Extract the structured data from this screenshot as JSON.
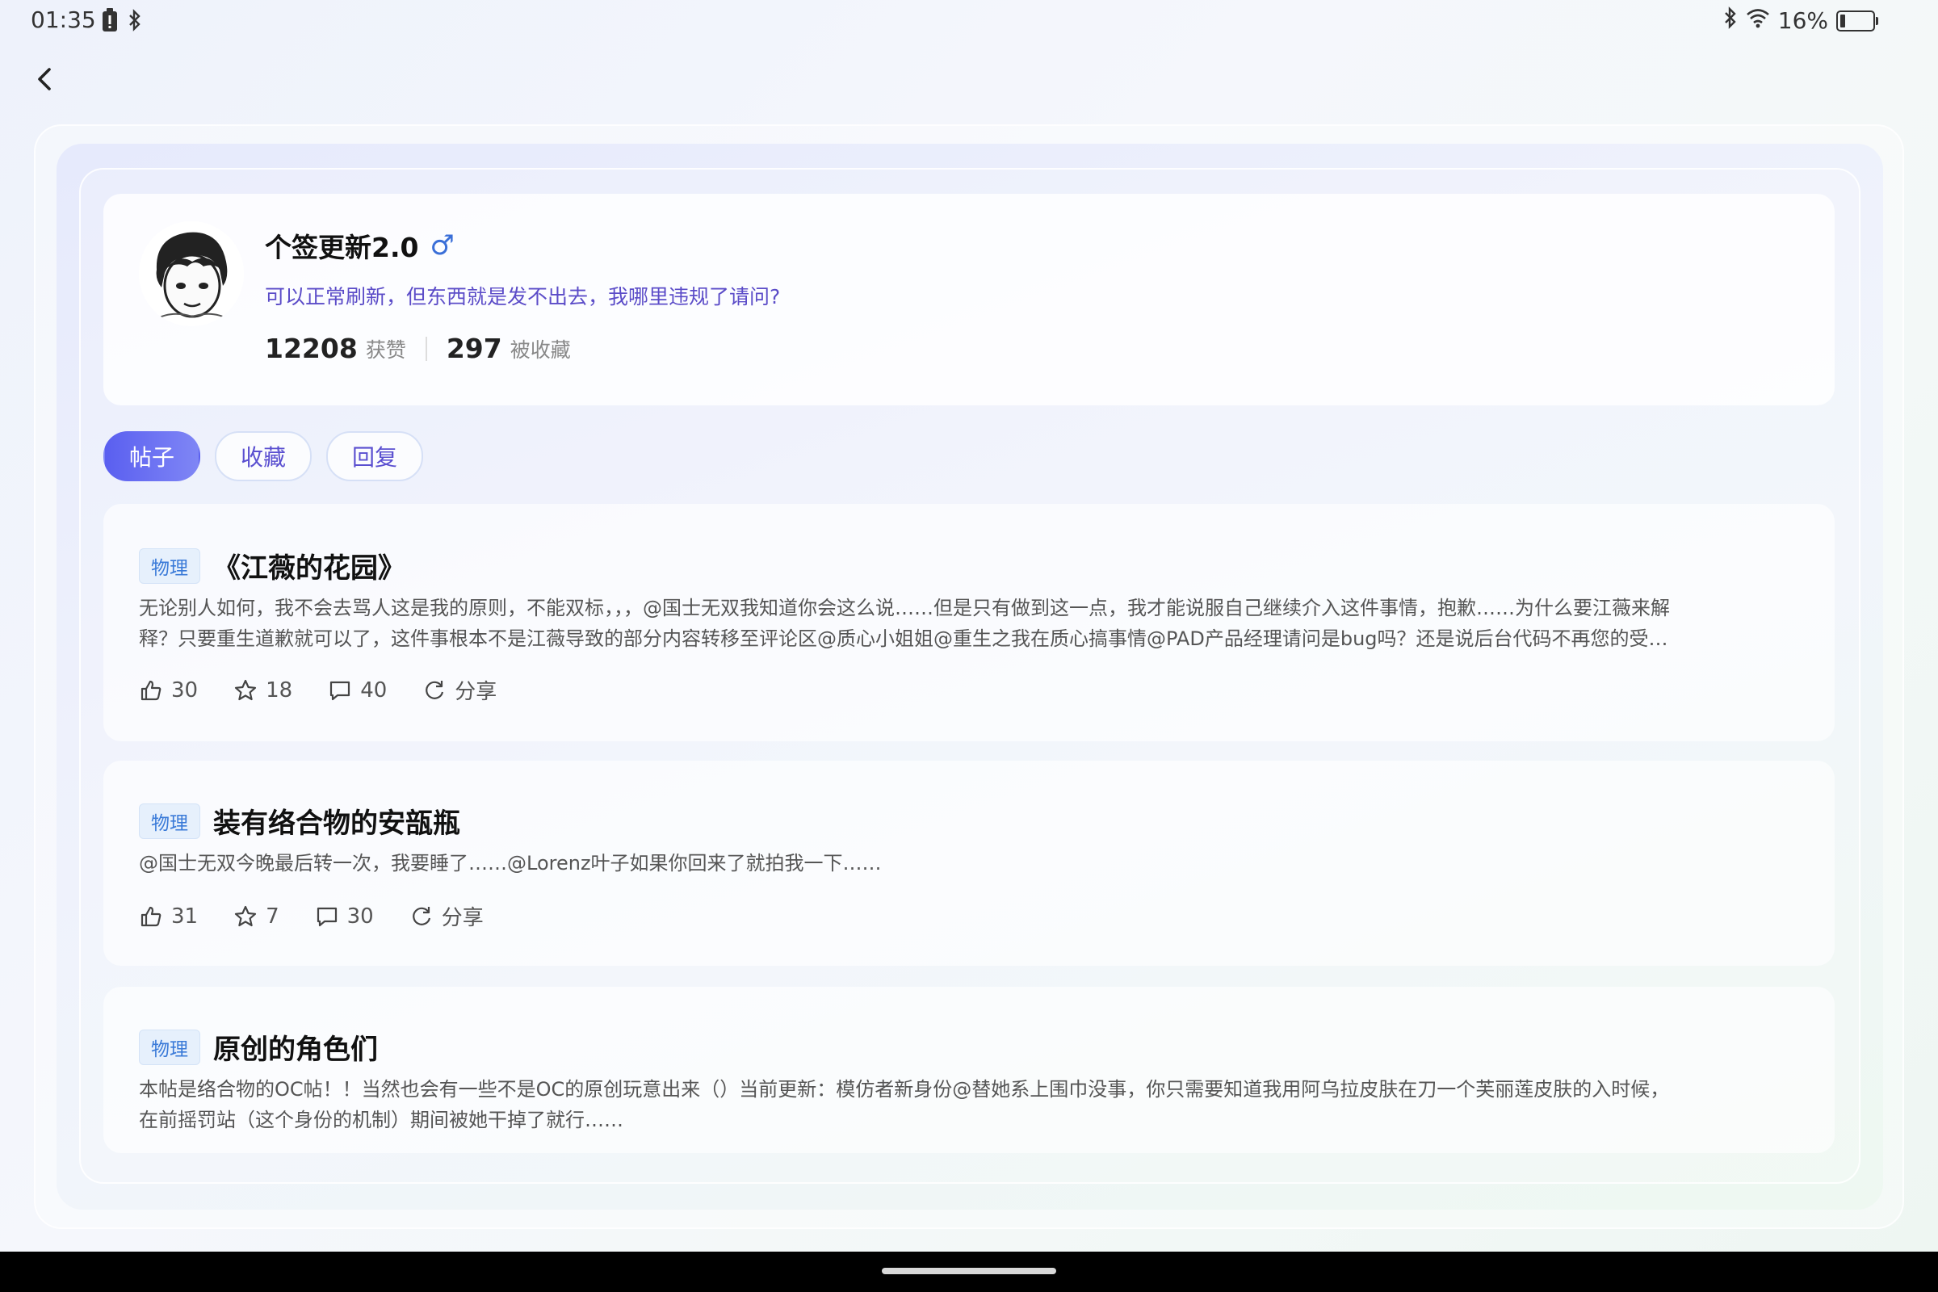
{
  "status_bar": {
    "time": "01:35",
    "battery_text": "16%",
    "battery_level": 0.16,
    "icons": [
      "battery-alert-icon",
      "bluetooth-icon",
      "wifi-icon",
      "battery-icon"
    ]
  },
  "header": {
    "back_icon": "chevron-left-icon"
  },
  "profile": {
    "username": "个签更新2.0",
    "gender_symbol": "♂",
    "bio": "可以正常刷新，但东西就是发不出去，我哪里违规了请问?",
    "likes_count": "12208",
    "likes_label": "获赞",
    "favorited_count": "297",
    "favorited_label": "被收藏"
  },
  "tabs": [
    {
      "label": "帖子",
      "active": true
    },
    {
      "label": "收藏",
      "active": false
    },
    {
      "label": "回复",
      "active": false
    }
  ],
  "posts": [
    {
      "tag": "物理",
      "title": "《江薇的花园》",
      "excerpt_line1": "无论别人如何，我不会去骂人这是我的原则，不能双标，，，@国士无双我知道你会这么说……但是只有做到这一点，我才能说服自己继续介入这件事情，抱歉……为什么要江薇来解",
      "excerpt_line2": "释？只要重生道歉就可以了，这件事根本不是江薇导致的部分内容转移至评论区@质心小姐姐@重生之我在质心搞事情@PAD产品经理请问是bug吗？还是说后台代码不再您的受…",
      "likes": "30",
      "stars": "18",
      "comments": "40",
      "share_label": "分享"
    },
    {
      "tag": "物理",
      "title": "装有络合物的安瓿瓶",
      "excerpt_line1": "@国士无双今晚最后转一次，我要睡了……@Lorenz叶子如果你回来了就拍我一下……",
      "likes": "31",
      "stars": "7",
      "comments": "30",
      "share_label": "分享"
    },
    {
      "tag": "物理",
      "title": "原创的角色们",
      "excerpt_line1": "本帖是络合物的OC帖！！当然也会有一些不是OC的原创玩意出来（）当前更新：模仿者新身份@替她系上围巾没事，你只需要知道我用阿乌拉皮肤在刀一个芙丽莲皮肤的入时候，",
      "excerpt_line2": "在前摇罚站（这个身份的机制）期间被她干掉了就行……"
    }
  ],
  "icons": {
    "like": "thumbs-up-icon",
    "star": "star-icon",
    "comment": "comment-icon",
    "share": "share-icon"
  }
}
